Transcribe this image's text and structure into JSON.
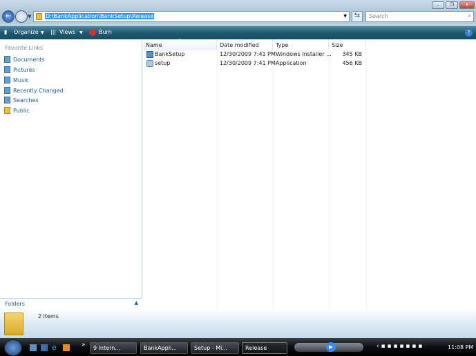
{
  "window": {
    "minimize": "–",
    "maximize": "❐",
    "close": "✕"
  },
  "address": {
    "path": "D:\\BankApplication\\BankSetup\\Release",
    "placeholder": "Search"
  },
  "toolbar": {
    "organize": "Organize",
    "views": "Views",
    "burn": "Burn",
    "help": "?"
  },
  "sidebar": {
    "title": "Favorite Links",
    "items": [
      {
        "label": "Documents"
      },
      {
        "label": "Pictures"
      },
      {
        "label": "Music"
      },
      {
        "label": "Recently Changed"
      },
      {
        "label": "Searches"
      },
      {
        "label": "Public"
      }
    ],
    "folders": "Folders"
  },
  "columns": {
    "name": "Name",
    "date": "Date modified",
    "type": "Type",
    "size": "Size"
  },
  "files": [
    {
      "name": "BankSetup",
      "date": "12/30/2009 7:41 PM",
      "type": "Windows Installer ...",
      "size": "345 KB"
    },
    {
      "name": "setup",
      "date": "12/30/2009 7:41 PM",
      "type": "Application",
      "size": "456 KB"
    }
  ],
  "details": {
    "count": "2 items"
  },
  "taskbar": {
    "tasks": [
      "9 Intern...",
      "BankAppli...",
      "Setup - Mi...",
      "Release"
    ],
    "clock": "11:08 PM",
    "more": "»"
  }
}
